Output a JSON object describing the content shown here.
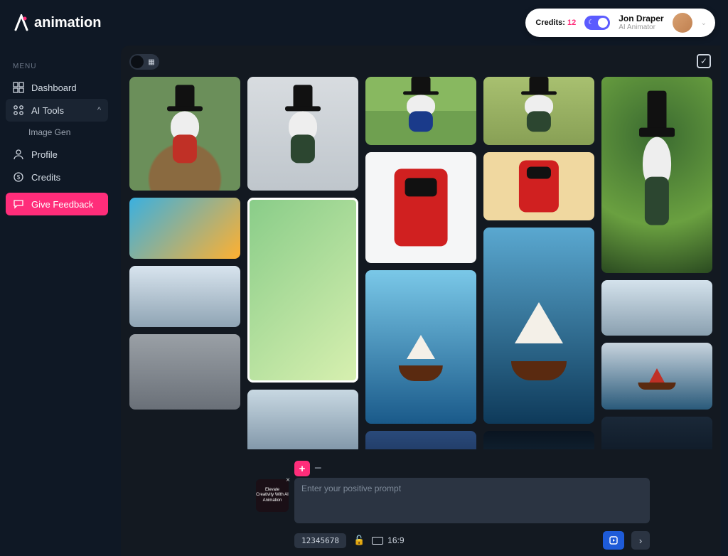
{
  "brand": "animation",
  "header": {
    "credits_label": "Credits:",
    "credits_value": "12",
    "user_name": "Jon Draper",
    "user_role": "AI Animator"
  },
  "sidebar": {
    "menu_label": "MENU",
    "items": {
      "dashboard": "Dashboard",
      "ai_tools": "AI Tools",
      "image_gen": "Image Gen",
      "profile": "Profile",
      "credits": "Credits",
      "feedback": "Give Feedback"
    }
  },
  "prompt": {
    "placeholder": "Enter your positive prompt",
    "seed": "12345678",
    "aspect": "16:9",
    "thumb_caption": "Elevate Creativity With AI Animation"
  },
  "gallery": {
    "columns": [
      [
        {
          "id": "gnome-red-tophat",
          "selected": false
        },
        {
          "id": "phoenix-boy-flying",
          "selected": false
        },
        {
          "id": "bear-snow-rider-1",
          "selected": false
        },
        {
          "id": "man-gold-jacket-street",
          "selected": false
        }
      ],
      [
        {
          "id": "gnome-green-tophat-studio",
          "selected": false
        },
        {
          "id": "boy-vs-dinosaur-comic",
          "selected": true
        },
        {
          "id": "bear-snow-rider-2",
          "selected": false
        }
      ],
      [
        {
          "id": "gnome-blue-suit-lawn",
          "selected": false
        },
        {
          "id": "red-robot-white-bg",
          "selected": false
        },
        {
          "id": "sailboat-iceberg-canyon",
          "selected": false
        },
        {
          "id": "victorian-house-night",
          "selected": false
        }
      ],
      [
        {
          "id": "gnome-green-garden-pots",
          "selected": false
        },
        {
          "id": "red-robot-cartoon-room",
          "selected": false
        },
        {
          "id": "sailing-ship-ice-cave",
          "selected": false
        },
        {
          "id": "glacier-blue-light",
          "selected": false
        }
      ],
      [
        {
          "id": "gnome-green-tophat-bokeh",
          "selected": false
        },
        {
          "id": "bear-snow-rider-3",
          "selected": false
        },
        {
          "id": "red-sailboat-mountain-sea",
          "selected": false
        },
        {
          "id": "dark-forest-ruin",
          "selected": false
        }
      ]
    ]
  }
}
